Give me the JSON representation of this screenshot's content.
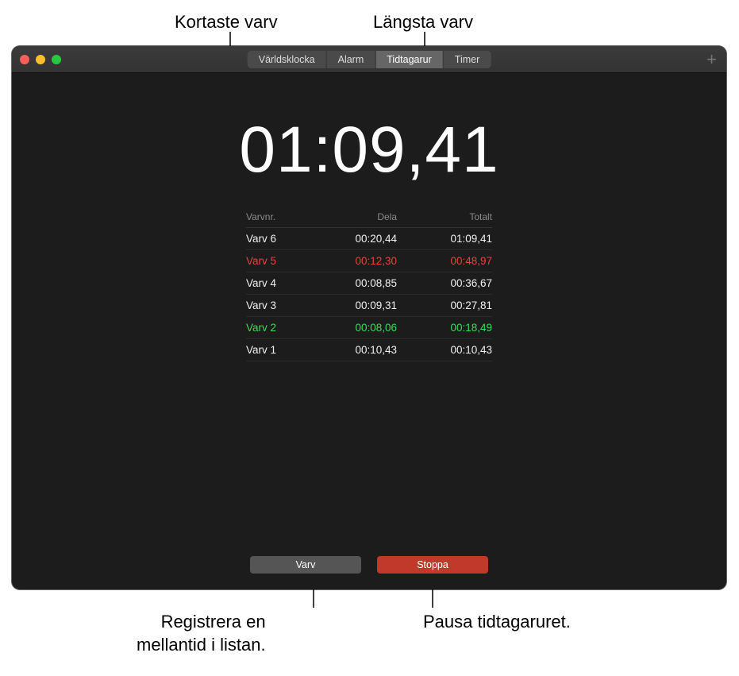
{
  "callouts": {
    "shortest": "Kortaste varv",
    "longest": "Längsta varv",
    "lapHint": "Registrera en\nmellantid i listan.",
    "stopHint": "Pausa tidtagaruret."
  },
  "toolbar": {
    "tabs": [
      "Världsklocka",
      "Alarm",
      "Tidtagarur",
      "Timer"
    ],
    "activeIndex": 2,
    "addLabel": "+"
  },
  "timer": {
    "display": "01:09,41"
  },
  "lapTable": {
    "headers": {
      "num": "Varvnr.",
      "split": "Dela",
      "total": "Totalt"
    },
    "rows": [
      {
        "num": "Varv 6",
        "split": "00:20,44",
        "total": "01:09,41",
        "kind": "normal"
      },
      {
        "num": "Varv 5",
        "split": "00:12,30",
        "total": "00:48,97",
        "kind": "longest"
      },
      {
        "num": "Varv 4",
        "split": "00:08,85",
        "total": "00:36,67",
        "kind": "normal"
      },
      {
        "num": "Varv 3",
        "split": "00:09,31",
        "total": "00:27,81",
        "kind": "normal"
      },
      {
        "num": "Varv 2",
        "split": "00:08,06",
        "total": "00:18,49",
        "kind": "shortest"
      },
      {
        "num": "Varv 1",
        "split": "00:10,43",
        "total": "00:10,43",
        "kind": "normal"
      }
    ]
  },
  "buttons": {
    "lap": "Varv",
    "stop": "Stoppa"
  }
}
